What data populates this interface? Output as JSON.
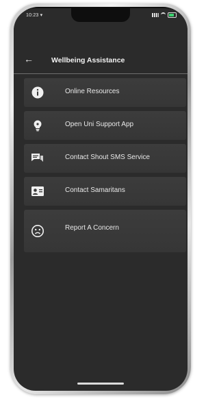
{
  "status": {
    "time": "10:23 ▾"
  },
  "appbar": {
    "title": "Wellbeing Assistance"
  },
  "items": [
    {
      "label": "Online Resources",
      "icon": "info-icon"
    },
    {
      "label": "Open Uni Support App",
      "icon": "lightbulb-icon"
    },
    {
      "label": "Contact Shout SMS Service",
      "icon": "chat-icon"
    },
    {
      "label": "Contact Samaritans",
      "icon": "contact-card-icon"
    },
    {
      "label": "Report A Concern",
      "icon": "sad-face-icon"
    }
  ],
  "colors": {
    "background": "#2b2b2b",
    "item": "#3a3a3a",
    "text": "#e9e9e9",
    "battery": "#3bd16f"
  }
}
